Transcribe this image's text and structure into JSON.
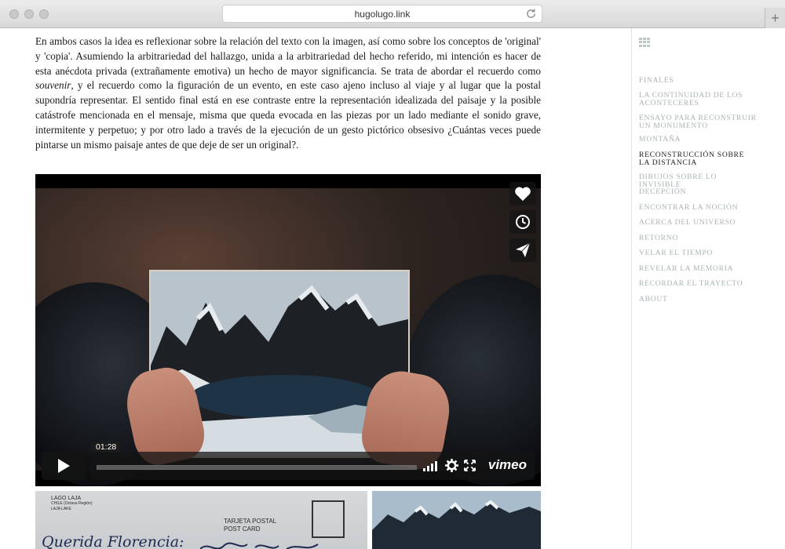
{
  "browser": {
    "url": "hugolugo.link",
    "new_tab_label": "+"
  },
  "article": {
    "paragraph_part1": "En ambos casos la idea es reflexionar sobre la relación del texto con la imagen, así como sobre los conceptos de 'original' y 'copia'. Asumiendo la arbitrariedad del hallazgo, unida a la arbitrariedad del hecho referido, mi intención es hacer de esta anécdota privada (extrañamente emotiva) un hecho de mayor significancia. Se trata de abordar el recuerdo como ",
    "paragraph_emphasis": "souvenir",
    "paragraph_part2": ", y el recuerdo como la figuración de un evento, en este caso ajeno incluso al viaje y al lugar que la postal supondría representar. El sentido final está en ese contraste entre la representación idealizada del paisaje y la posible catástrofe mencionada en el mensaje, misma que queda evocada en las piezas por un lado mediante el sonido grave, intermitente y perpetuo; y por otro lado a través de la ejecución de un gesto pictórico obsesivo ¿Cuántas veces puede pintarse un mismo paisaje antes de que deje de ser un original?."
  },
  "video": {
    "time": "01:28",
    "brand": "vimeo",
    "progress": 0
  },
  "postcard": {
    "place_line1": "LAGO LAJA",
    "place_line2": "CHILE (Octava Región)",
    "place_line3": "LAJA LAKE",
    "label_line1": "TARJETA POSTAL",
    "label_line2": "POST CARD",
    "greeting": "Querida Florencia:"
  },
  "sidebar": {
    "items": [
      {
        "label": "FINALES",
        "active": false
      },
      {
        "label": "LA CONTINUIDAD DE LOS ACONTECERES",
        "active": false
      },
      {
        "label": "ENSAYO PARA RECONSTRUIR UN MONUMENTO",
        "active": false
      },
      {
        "label": "MONTAÑA",
        "active": false
      },
      {
        "label": "RECONSTRUCCIÓN SOBRE LA DISTANCIA",
        "active": true
      },
      {
        "label": "DIBUJOS SOBRE LO INVISIBLE",
        "active": false
      },
      {
        "label": "DECEPCIÓN",
        "active": false
      },
      {
        "label": "ENCONTRAR LA NOCIÓN",
        "active": false
      },
      {
        "label": "ACERCA DEL UNIVERSO",
        "active": false
      },
      {
        "label": "RETORNO",
        "active": false
      },
      {
        "label": "VELAR EL TIEMPO",
        "active": false
      },
      {
        "label": "REVELAR LA MEMORIA",
        "active": false
      },
      {
        "label": "RECORDAR EL TRAYECTO",
        "active": false
      },
      {
        "label": "ABOUT",
        "active": false
      }
    ]
  },
  "colors": {
    "nav_inactive": "#a9b3b5",
    "nav_active": "#222222"
  }
}
